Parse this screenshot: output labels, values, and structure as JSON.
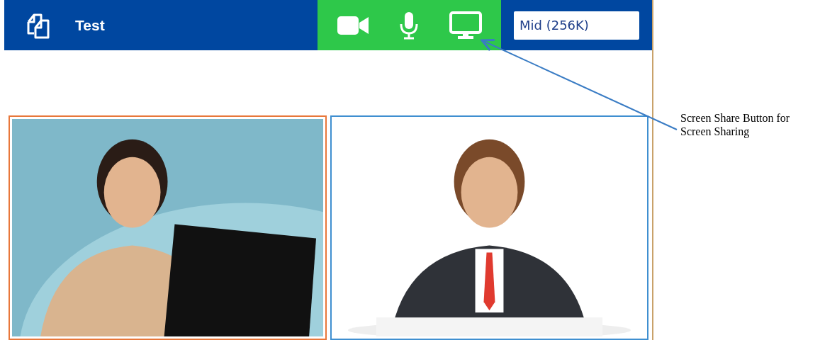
{
  "app": {
    "title": "Test"
  },
  "controls": [
    {
      "kind": "camera"
    },
    {
      "kind": "microphone"
    },
    {
      "kind": "screen"
    }
  ],
  "quality_field": {
    "value": "Mid (256K)"
  },
  "annotation": {
    "text": "Screen Share Button for Screen Sharing"
  }
}
